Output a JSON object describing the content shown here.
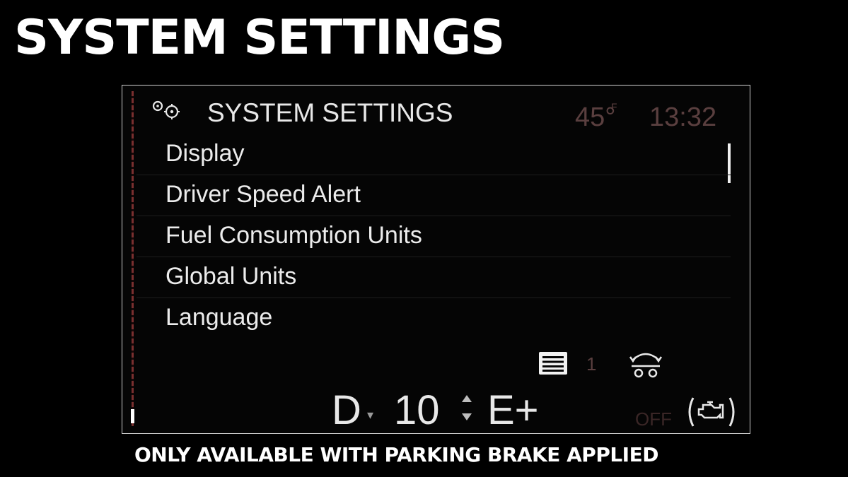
{
  "page_heading": "SYSTEM SETTINGS",
  "screen": {
    "title_icon": "gears-icon",
    "title": "SYSTEM SETTINGS",
    "temperature": "45°",
    "temperature_unit": "F",
    "time": "13:32",
    "menu_items": [
      "Display",
      "Driver Speed Alert",
      "Fuel Consumption Units",
      "Global Units",
      "Language"
    ],
    "status": {
      "document_icon": "document-list-icon",
      "document_count": "1",
      "tow_icon": "tow-haul-icon",
      "gear": "D",
      "gear_down_arrow": "▾",
      "gear_number": "10",
      "gear_updown_icon": "gear-up-down-icon",
      "mode": "E+",
      "engine_state": "OFF",
      "engine_icon": "engine-auto-stop-icon"
    }
  },
  "footer_note": "ONLY AVAILABLE WITH PARKING BRAKE APPLIED",
  "colors": {
    "background": "#000000",
    "text": "#ececec",
    "dim_red": "#5a3f3f",
    "scroll_track": "#7a2f2f"
  }
}
